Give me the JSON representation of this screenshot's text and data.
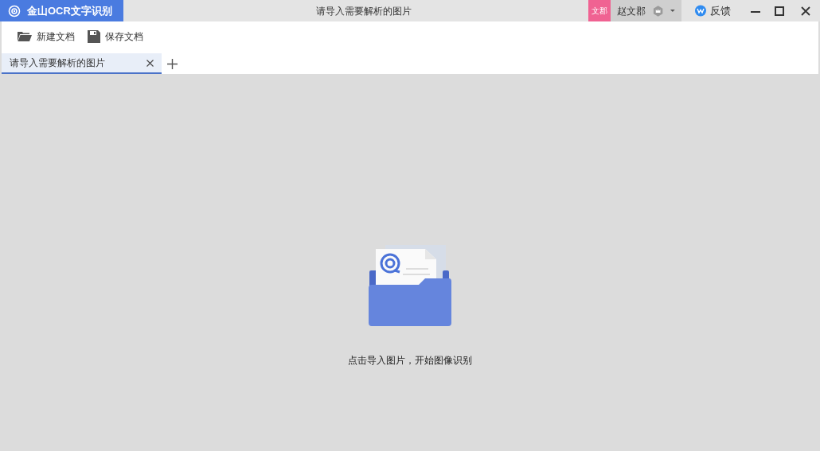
{
  "app": {
    "name": "金山OCR文字识别"
  },
  "window": {
    "title": "请导入需要解析的图片"
  },
  "user": {
    "badge": "文郡",
    "name": "赵文郡"
  },
  "feedback": {
    "label": "反馈"
  },
  "toolbar": [
    {
      "kind": "new",
      "label": "新建文档"
    },
    {
      "kind": "save",
      "label": "保存文档"
    }
  ],
  "tabs": [
    {
      "label": "请导入需要解析的图片",
      "selected": true
    }
  ],
  "empty_state": {
    "message": "点击导入图片，开始图像识别"
  }
}
